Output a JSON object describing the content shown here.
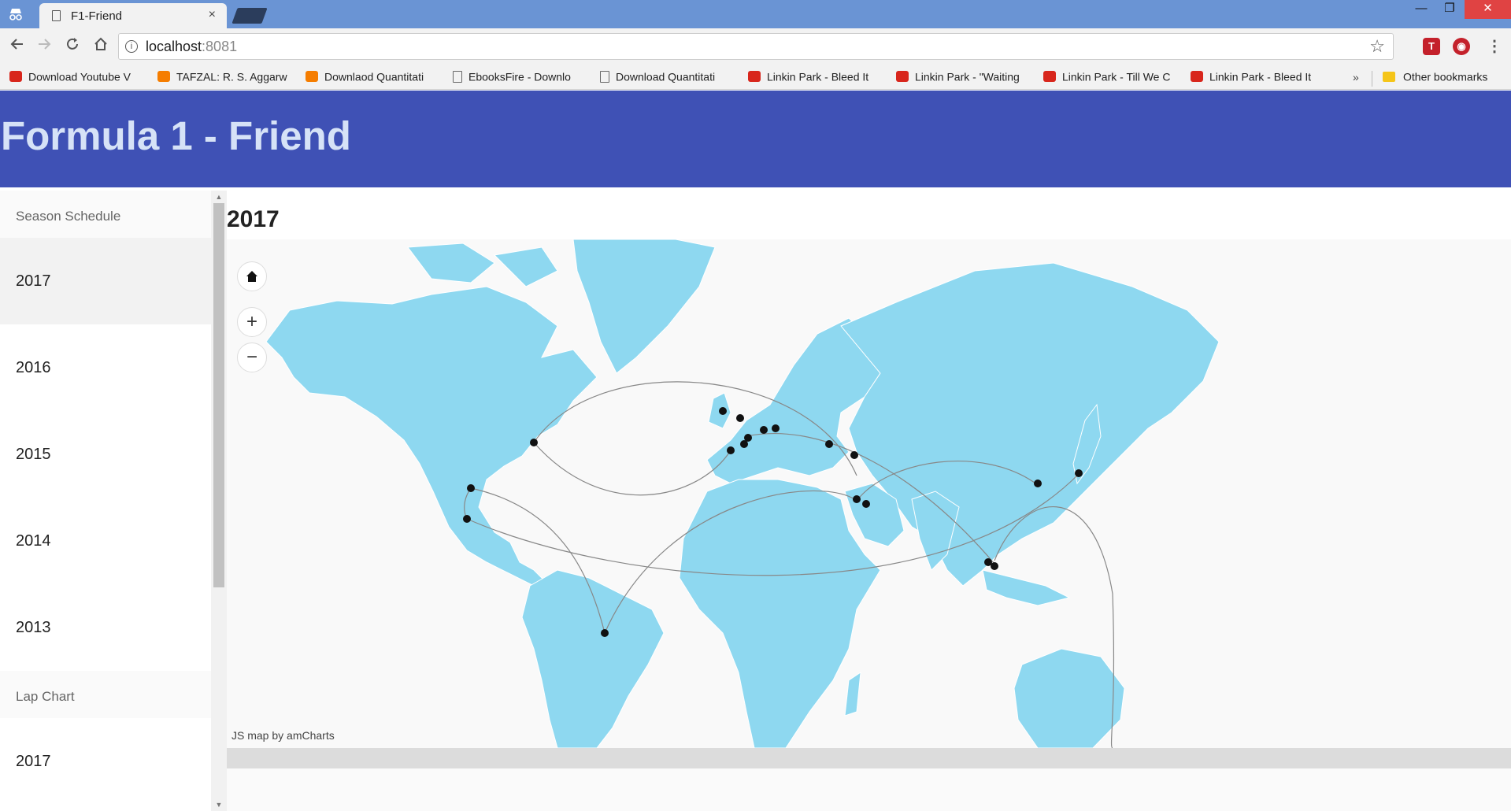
{
  "browser": {
    "tab_title": "F1-Friend",
    "tab_close": "×",
    "url_host": "localhost",
    "url_port": ":8081",
    "window_buttons": {
      "minimize": "—",
      "maximize": "❐",
      "close": "✕"
    },
    "bookmarks": [
      {
        "label": "Download Youtube V",
        "icon": "youtube-icon"
      },
      {
        "label": "TAFZAL: R. S. Aggarw",
        "icon": "blogger-icon"
      },
      {
        "label": "Downlaod Quantitati",
        "icon": "blogger-icon"
      },
      {
        "label": "EbooksFire - Downlo",
        "icon": "page-icon"
      },
      {
        "label": "Download Quantitati",
        "icon": "page-icon"
      },
      {
        "label": "Linkin Park - Bleed It",
        "icon": "youtube-icon"
      },
      {
        "label": "Linkin Park - \"Waiting",
        "icon": "youtube-icon"
      },
      {
        "label": "Linkin Park - Till We C",
        "icon": "youtube-icon"
      },
      {
        "label": "Linkin Park - Bleed It",
        "icon": "youtube-icon"
      }
    ],
    "bookmarks_more": "»",
    "other_bookmarks": "Other bookmarks"
  },
  "app": {
    "title": "Formula 1 - Friend"
  },
  "sidebar": {
    "sections": [
      {
        "header": "Season Schedule",
        "items": [
          "2017",
          "2016",
          "2015",
          "2014",
          "2013"
        ]
      },
      {
        "header": "Lap Chart",
        "items": [
          "2017"
        ]
      }
    ],
    "active_item": "2017"
  },
  "main": {
    "year": "2017",
    "map_credit": "JS map by amCharts",
    "land_color": "#8ed8f0",
    "marker_color": "#111111",
    "route_color": "#888888"
  }
}
